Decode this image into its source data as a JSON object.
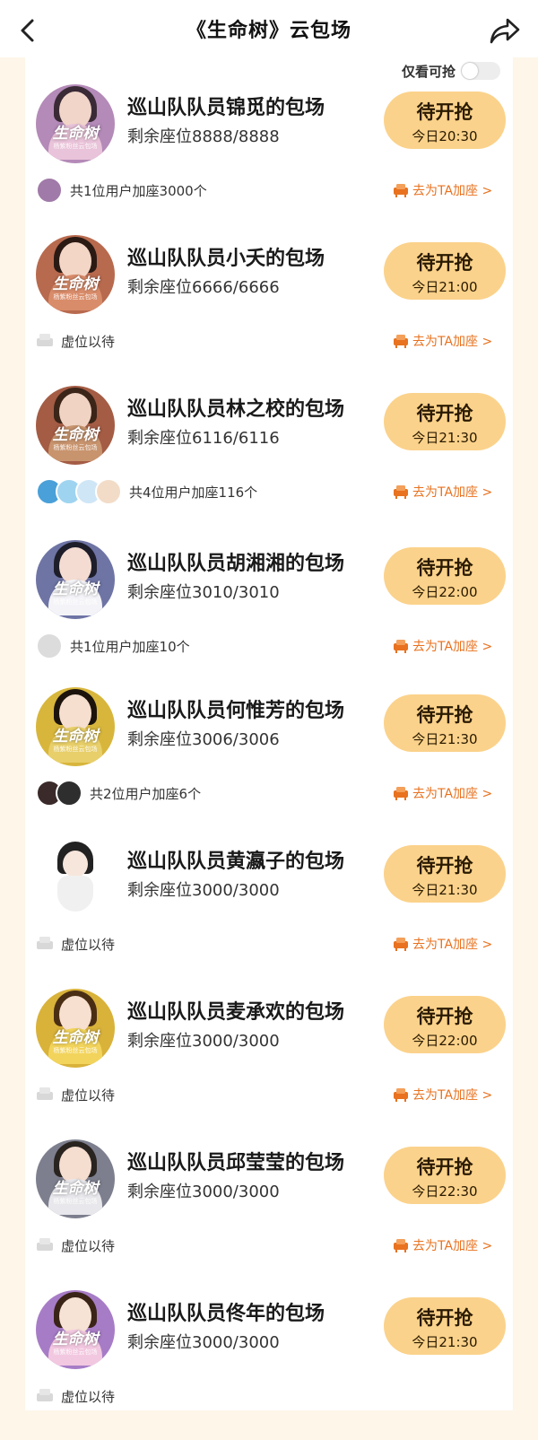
{
  "header": {
    "title": "《生命树》云包场"
  },
  "filter": {
    "label": "仅看可抢",
    "on": false
  },
  "common": {
    "logo_text": "生命树",
    "logo_sub": "杨紫粉丝云包场",
    "join_label": "去为TA加座 >",
    "button_label": "待开抢"
  },
  "items": [
    {
      "title": "巡山队队员锦觅的包场",
      "seats": "剩余座位8888/8888",
      "time": "今日20:30",
      "footer": "共1位用户加座3000个"
    },
    {
      "title": "巡山队队员小夭的包场",
      "seats": "剩余座位6666/6666",
      "time": "今日21:00",
      "footer": "虚位以待"
    },
    {
      "title": "巡山队队员林之校的包场",
      "seats": "剩余座位6116/6116",
      "time": "今日21:30",
      "footer": "共4位用户加座116个"
    },
    {
      "title": "巡山队队员胡湘湘的包场",
      "seats": "剩余座位3010/3010",
      "time": "今日22:00",
      "footer": "共1位用户加座10个"
    },
    {
      "title": "巡山队队员何惟芳的包场",
      "seats": "剩余座位3006/3006",
      "time": "今日21:30",
      "footer": "共2位用户加座6个"
    },
    {
      "title": "巡山队队员黄瀛子的包场",
      "seats": "剩余座位3000/3000",
      "time": "今日21:30",
      "footer": "虚位以待"
    },
    {
      "title": "巡山队队员麦承欢的包场",
      "seats": "剩余座位3000/3000",
      "time": "今日22:00",
      "footer": "虚位以待"
    },
    {
      "title": "巡山队队员邱莹莹的包场",
      "seats": "剩余座位3000/3000",
      "time": "今日22:30",
      "footer": "虚位以待"
    },
    {
      "title": "巡山队队员佟年的包场",
      "seats": "剩余座位3000/3000",
      "time": "今日21:30",
      "footer": "虚位以待"
    }
  ],
  "colors": {
    "accent": "#e8721f",
    "button_bg": "#fbd28b",
    "page_bg": "#fdf6e9"
  }
}
